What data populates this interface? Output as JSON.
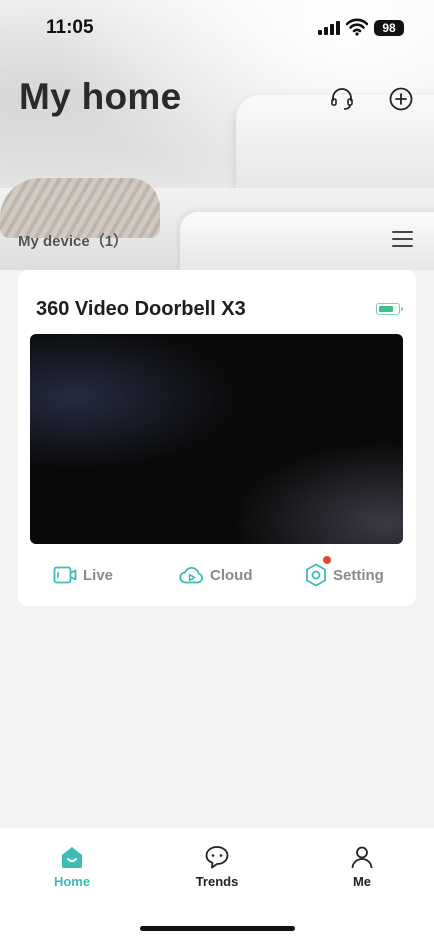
{
  "status_bar": {
    "time": "11:05",
    "battery": "98"
  },
  "header": {
    "title": "My home",
    "support_icon": "headset-icon",
    "add_icon": "plus-circle-icon"
  },
  "devices_section": {
    "heading": "My device（1）",
    "menu_icon": "hamburger-menu-icon"
  },
  "device_card": {
    "name": "360 Video Doorbell X3",
    "battery_level": 0.8,
    "actions": [
      {
        "label": "Live",
        "icon": "video-icon"
      },
      {
        "label": "Cloud",
        "icon": "cloud-play-icon"
      },
      {
        "label": "Setting",
        "icon": "hex-gear-icon",
        "has_badge": true
      }
    ]
  },
  "tabs": [
    {
      "label": "Home",
      "icon": "home-icon",
      "active": true
    },
    {
      "label": "Trends",
      "icon": "chat-bubble-icon",
      "active": false
    },
    {
      "label": "Me",
      "icon": "person-icon",
      "active": false
    }
  ],
  "colors": {
    "accent": "#3dbcb3",
    "badge": "#e0462d",
    "battery": "#44c08a",
    "inactive_action": "#8a8a8a"
  }
}
